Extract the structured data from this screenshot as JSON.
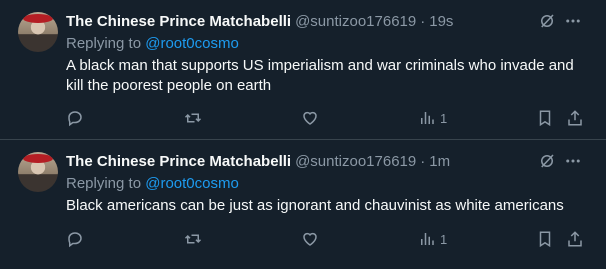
{
  "tweets": [
    {
      "name": "The Chinese Prince Matchabelli",
      "handle": "@suntizoo176619",
      "time": "19s",
      "replying_prefix": "Replying to",
      "replying_to": "@root0cosmo",
      "text": "A black man that supports US imperialism and war criminals who invade and kill the poorest people on earth",
      "views": "1"
    },
    {
      "name": "The Chinese Prince Matchabelli",
      "handle": "@suntizoo176619",
      "time": "1m",
      "replying_prefix": "Replying to",
      "replying_to": "@root0cosmo",
      "text": "Black americans can be just as ignorant and chauvinist as white americans",
      "views": "1"
    }
  ],
  "icons": [
    "reply-icon",
    "retweet-icon",
    "like-icon",
    "views-icon",
    "bookmark-icon",
    "share-icon",
    "grok-icon",
    "more-icon"
  ],
  "colors": {
    "background": "#15202b",
    "accent": "#1d9bf0",
    "muted": "#8b98a5",
    "divider": "#38444d"
  }
}
